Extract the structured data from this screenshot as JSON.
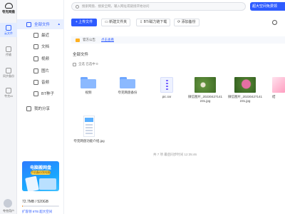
{
  "app": {
    "logo_text": "夸克网盘"
  },
  "rail": {
    "items": [
      {
        "label": "云文件",
        "active": true
      },
      {
        "label": "传输"
      },
      {
        "label": "同步备份"
      },
      {
        "label": "夸克AI"
      }
    ],
    "user_name": "夸克用户"
  },
  "sidebar": {
    "items": [
      {
        "label": "全部文件",
        "active": true,
        "caret": "▴",
        "icon": "folder-icon"
      },
      {
        "label": "最近",
        "icon": "clock-icon"
      },
      {
        "label": "文档",
        "icon": "doc-icon"
      },
      {
        "label": "视频",
        "icon": "video-icon"
      },
      {
        "label": "图片",
        "icon": "image-icon"
      },
      {
        "label": "音频",
        "icon": "music-icon"
      },
      {
        "label": "BT种子",
        "icon": "bt-icon"
      },
      {
        "label": "我的分享",
        "icon": "share-icon"
      }
    ],
    "promo": {
      "title": "电脑搬网盘",
      "subtitle": "手机备份到电脑"
    },
    "storage": {
      "text": "72.7MB / 520GB",
      "used_fraction": 0.01,
      "link": "扩容领 6TB 超大空间"
    }
  },
  "header": {
    "search_placeholder": "搜索网盘、搜索全网，输入网址或链接开始访问",
    "member_button": "超大空间免费领"
  },
  "toolbar": {
    "upload": "上传文件",
    "new_folder": "新建文件夹",
    "bt_download": "BT/磁力链下载",
    "add_backup": "添加备份"
  },
  "notice": {
    "label": "官方公告",
    "link": "点击查看"
  },
  "breadcrumb": "全部文件",
  "selection": {
    "text": "全选 已选中 0"
  },
  "files": [
    {
      "name": "视频",
      "kind": "folder"
    },
    {
      "name": "夸克网盘备份",
      "kind": "folder"
    },
    {
      "name": "pic.rar",
      "kind": "archive"
    },
    {
      "name": "微信图片_20230427141231.jpg",
      "kind": "photo-green"
    },
    {
      "name": "微信图片_20230427141231.jpg",
      "kind": "photo-pink"
    },
    {
      "name": "结",
      "kind": "photo-cut"
    },
    {
      "name": "夸克网盘功能介绍.jpg",
      "kind": "tall"
    }
  ],
  "footer_note": "共 7 项 最后同步时间 12:35:46"
}
